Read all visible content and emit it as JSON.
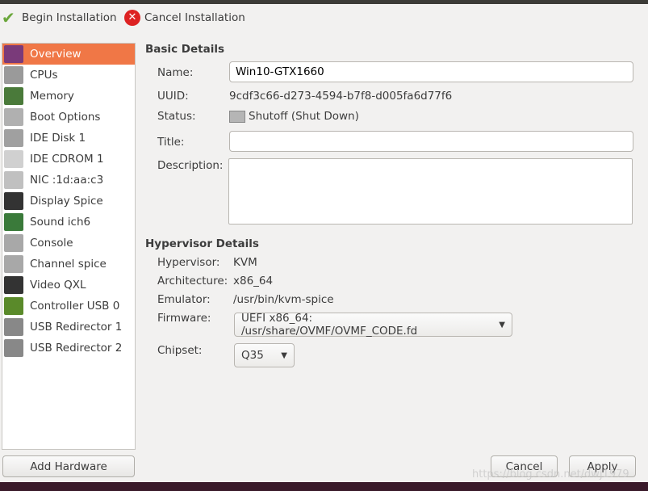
{
  "toolbar": {
    "begin": "Begin Installation",
    "cancel": "Cancel Installation"
  },
  "sidebar": {
    "items": [
      {
        "label": "Overview",
        "icon": "monitor-icon",
        "color": "#7a3a7a"
      },
      {
        "label": "CPUs",
        "icon": "cpu-icon",
        "color": "#9a9a9a"
      },
      {
        "label": "Memory",
        "icon": "memory-icon",
        "color": "#4a7a3a"
      },
      {
        "label": "Boot Options",
        "icon": "gears-icon",
        "color": "#b0b0b0"
      },
      {
        "label": "IDE Disk 1",
        "icon": "disk-icon",
        "color": "#a0a0a0"
      },
      {
        "label": "IDE CDROM 1",
        "icon": "cdrom-icon",
        "color": "#d0d0d0"
      },
      {
        "label": "NIC :1d:aa:c3",
        "icon": "network-icon",
        "color": "#c0c0c0"
      },
      {
        "label": "Display Spice",
        "icon": "display-icon",
        "color": "#333333"
      },
      {
        "label": "Sound ich6",
        "icon": "sound-icon",
        "color": "#3a7a3a"
      },
      {
        "label": "Console",
        "icon": "console-icon",
        "color": "#a8a8a8"
      },
      {
        "label": "Channel spice",
        "icon": "channel-icon",
        "color": "#a8a8a8"
      },
      {
        "label": "Video QXL",
        "icon": "video-icon",
        "color": "#333333"
      },
      {
        "label": "Controller USB 0",
        "icon": "controller-icon",
        "color": "#5a8a2a"
      },
      {
        "label": "USB Redirector 1",
        "icon": "usb-icon",
        "color": "#888888"
      },
      {
        "label": "USB Redirector 2",
        "icon": "usb-icon",
        "color": "#888888"
      }
    ]
  },
  "basic": {
    "heading": "Basic Details",
    "name_label": "Name:",
    "name": "Win10-GTX1660",
    "uuid_label": "UUID:",
    "uuid": "9cdf3c66-d273-4594-b7f8-d005fa6d77f6",
    "status_label": "Status:",
    "status": "Shutoff (Shut Down)",
    "title_label": "Title:",
    "title": "",
    "desc_label": "Description:",
    "desc": ""
  },
  "hyper": {
    "heading": "Hypervisor Details",
    "hv_label": "Hypervisor:",
    "hv": "KVM",
    "arch_label": "Architecture:",
    "arch": "x86_64",
    "emu_label": "Emulator:",
    "emu": "/usr/bin/kvm-spice",
    "fw_label": "Firmware:",
    "fw": "UEFI x86_64: /usr/share/OVMF/OVMF_CODE.fd",
    "chip_label": "Chipset:",
    "chip": "Q35"
  },
  "footer": {
    "add": "Add Hardware",
    "cancel": "Cancel",
    "apply": "Apply",
    "watermark": "https://blog.csdn.net/dwj1979"
  },
  "accent": "#f07746"
}
